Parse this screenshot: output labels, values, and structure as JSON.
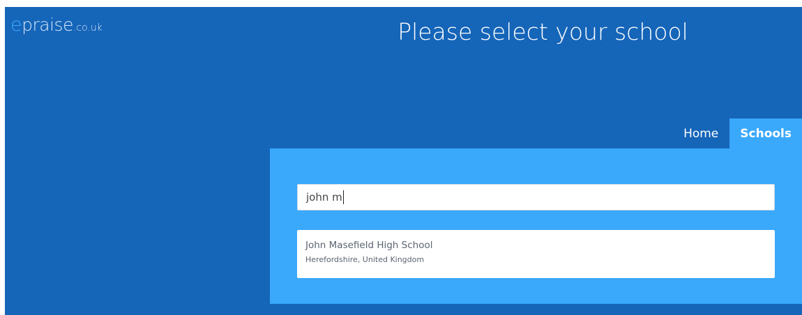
{
  "logo": {
    "e": "e",
    "rest": "praise",
    "tld": ".co.uk"
  },
  "page_title": "Please select your school",
  "nav": {
    "items": [
      {
        "label": "Home",
        "active": false
      },
      {
        "label": "Schools",
        "active": true
      }
    ]
  },
  "search": {
    "value": "john m"
  },
  "results": [
    {
      "name": "John Masefield High School",
      "location": "Herefordshire, United Kingdom"
    }
  ],
  "colors": {
    "background": "#1565b9",
    "panel": "#3aa8fb",
    "logo_accent": "#3ba7ff"
  }
}
